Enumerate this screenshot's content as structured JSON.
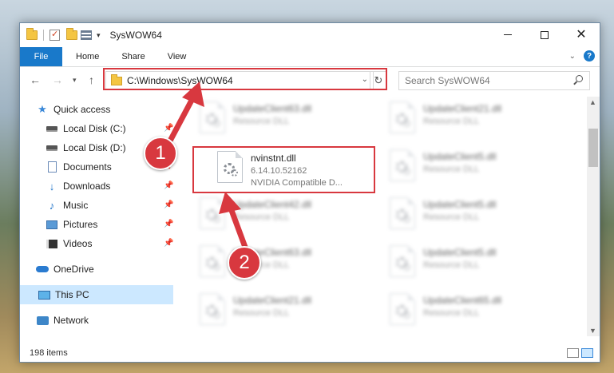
{
  "window": {
    "title": "SysWOW64",
    "minimize_label": "",
    "maximize_label": "",
    "close_label": "✕"
  },
  "ribbon": {
    "file": "File",
    "home": "Home",
    "share": "Share",
    "view": "View"
  },
  "address": {
    "path": "C:\\Windows\\SysWOW64",
    "search_placeholder": "Search SysWOW64"
  },
  "sidebar": {
    "items": [
      {
        "label": "Quick access",
        "icon": "star-icon"
      },
      {
        "label": "Local Disk (C:)",
        "icon": "drive-icon"
      },
      {
        "label": "Local Disk (D:)",
        "icon": "drive-icon"
      },
      {
        "label": "Documents",
        "icon": "document-icon"
      },
      {
        "label": "Downloads",
        "icon": "download-icon"
      },
      {
        "label": "Music",
        "icon": "music-icon"
      },
      {
        "label": "Pictures",
        "icon": "pictures-icon"
      },
      {
        "label": "Videos",
        "icon": "videos-icon"
      },
      {
        "label": "OneDrive",
        "icon": "cloud-icon"
      },
      {
        "label": "This PC",
        "icon": "pc-icon"
      },
      {
        "label": "Network",
        "icon": "network-icon"
      }
    ]
  },
  "files": {
    "highlighted": {
      "name": "nvinstnt.dll",
      "version": "6.14.10.52162",
      "description": "NVIDIA Compatible D..."
    },
    "blurred": [
      {
        "name": "UpdateClient63.dll",
        "type": "Resource DLL"
      },
      {
        "name": "UpdateClient21.dll",
        "type": "Resource DLL"
      },
      {
        "name": "UpdateClient5.dll",
        "type": "Resource DLL"
      },
      {
        "name": "UpdateClient42.dll",
        "type": "Resource DLL"
      },
      {
        "name": "UpdateClient5.dll",
        "type": "Resource DLL"
      },
      {
        "name": "UpdateClient63.dll",
        "type": "Resource DLL"
      },
      {
        "name": "UpdateClient5.dll",
        "type": "Resource DLL"
      },
      {
        "name": "UpdateClient21.dll",
        "type": "Resource DLL"
      },
      {
        "name": "UpdateClient65.dll",
        "type": "Resource DLL"
      }
    ]
  },
  "status": {
    "count": "198 items"
  },
  "callouts": {
    "one": "1",
    "two": "2"
  },
  "colors": {
    "accent": "#1979ca",
    "callout": "#d8383f",
    "selected": "#cce8ff"
  }
}
